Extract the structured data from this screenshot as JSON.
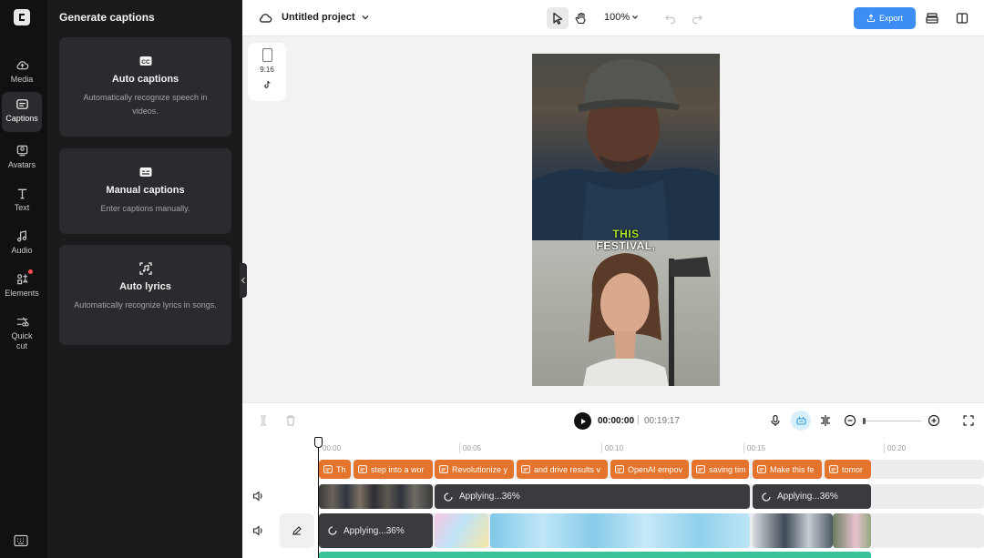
{
  "rail": {
    "items": [
      {
        "label": "Media",
        "icon": "cloud-upload-icon"
      },
      {
        "label": "Captions",
        "icon": "captions-icon",
        "active": true
      },
      {
        "label": "Avatars",
        "icon": "avatar-icon"
      },
      {
        "label": "Text",
        "icon": "text-icon"
      },
      {
        "label": "Audio",
        "icon": "music-note-icon"
      },
      {
        "label": "Elements",
        "icon": "elements-icon",
        "badge": true
      },
      {
        "label": "Quick cut",
        "icon": "scissors-icon"
      }
    ]
  },
  "panel": {
    "title": "Generate captions",
    "cards": [
      {
        "title": "Auto captions",
        "desc": "Automatically recognize speech in videos.",
        "icon": "cc-icon"
      },
      {
        "title": "Manual captions",
        "desc": "Enter captions manually.",
        "icon": "subtitle-icon"
      },
      {
        "title": "Auto lyrics",
        "desc": "Automatically recognize lyrics in songs.",
        "icon": "lyrics-icon"
      }
    ]
  },
  "topbar": {
    "project_title": "Untitled project",
    "zoom": "100%",
    "export_label": "Export"
  },
  "canvas": {
    "ratio_label": "9:16",
    "caption_line1": "THIS",
    "caption_line2": "FESTIVAL,"
  },
  "player": {
    "current_time": "00:00:00",
    "separator": "|",
    "duration": "00:19:17"
  },
  "timeline": {
    "ruler": [
      "00:00",
      "00:05",
      "00:10",
      "00:15",
      "00:20"
    ],
    "caption_clips": [
      "Th",
      "step into a wor",
      "Revolutionize y",
      "and drive results v",
      "OpenAI empov",
      "saving tim",
      "Make this fe",
      "tomor"
    ],
    "processing_label": "Applying...36%"
  },
  "colors": {
    "accent": "#3c8df5",
    "caption_clip": "#e4742c",
    "caption_highlight": "#a6e22e",
    "audio_track": "#3cc29b"
  }
}
